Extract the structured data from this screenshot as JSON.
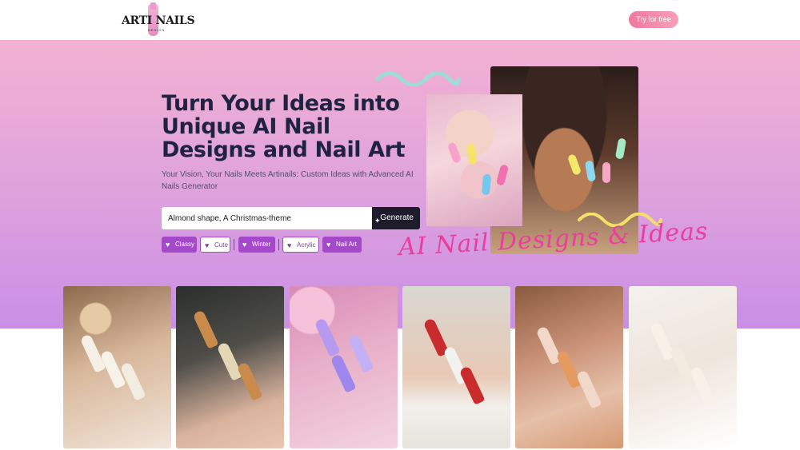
{
  "header": {
    "logo_text": "ARTI NAILS",
    "logo_sub": "DESIGN",
    "cta_label": "Try for free"
  },
  "hero": {
    "title": "Turn Your Ideas into Unique AI Nail Designs and Nail Art",
    "subtitle": "Your Vision, Your Nails Meets Artinails: Custom Ideas with Advanced AI Nails Generator",
    "search_value": "Almond shape, A Christmas-theme",
    "generate_label": "Generate",
    "script_caption": "AI Nail Designs & Ideas",
    "tags": [
      {
        "label": "Classy",
        "style": "solid"
      },
      {
        "label": "Cute",
        "style": "outline"
      },
      {
        "label": "Winter",
        "style": "solid"
      },
      {
        "label": "Acrylic",
        "style": "outline"
      },
      {
        "label": "Nail Art",
        "style": "solid"
      }
    ]
  },
  "colors": {
    "brand_pink": "#f0789f",
    "tag_purple": "#a349c9",
    "dark": "#1d1b2c",
    "script_pink": "#ec3c9e",
    "wave_teal": "#9fdcd6",
    "wave_yellow": "#f3df6a"
  },
  "icons": {
    "tag_icon": "heart-icon",
    "generate_icon": "sparkle-icon"
  }
}
